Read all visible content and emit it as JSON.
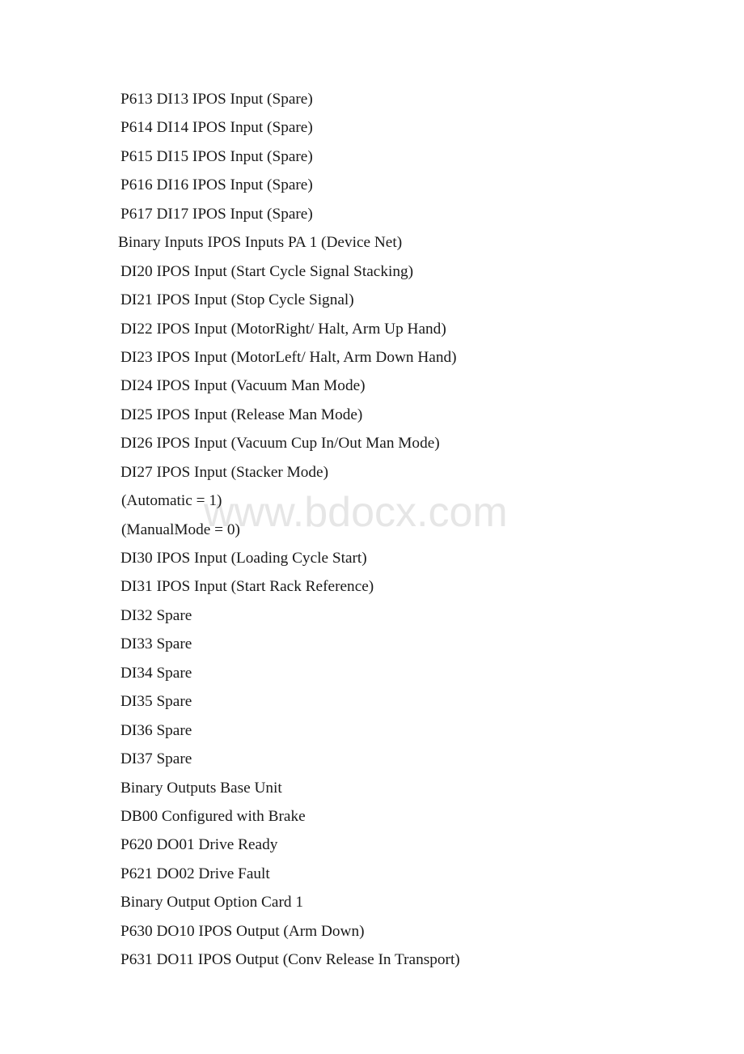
{
  "document": {
    "page_background": "#ffffff",
    "text_color": "#1a1a1a",
    "watermark": {
      "text": "www.bdocx.com",
      "color": "#e6e6e6"
    },
    "lines": [
      {
        "text": "P613 DI13 IPOS Input (Spare)",
        "indent": "normal"
      },
      {
        "text": "P614 DI14 IPOS Input (Spare)",
        "indent": "normal"
      },
      {
        "text": "P615 DI15 IPOS Input (Spare)",
        "indent": "normal"
      },
      {
        "text": "P616 DI16 IPOS Input (Spare)",
        "indent": "normal"
      },
      {
        "text": "P617 DI17 IPOS Input (Spare)",
        "indent": "normal"
      },
      {
        "text": "Binary Inputs IPOS Inputs PA 1 (Device Net)",
        "indent": "left"
      },
      {
        "text": "DI20 IPOS Input (Start Cycle Signal Stacking)",
        "indent": "normal"
      },
      {
        "text": "DI21 IPOS Input (Stop Cycle Signal)",
        "indent": "normal"
      },
      {
        "text": "DI22 IPOS Input (MotorRight/ Halt, Arm Up Hand)",
        "indent": "normal"
      },
      {
        "text": "DI23 IPOS Input (MotorLeft/ Halt, Arm Down Hand)",
        "indent": "normal"
      },
      {
        "text": "DI24 IPOS Input (Vacuum Man Mode)",
        "indent": "normal"
      },
      {
        "text": "DI25 IPOS Input (Release Man Mode)",
        "indent": "normal"
      },
      {
        "text": "DI26 IPOS Input (Vacuum Cup In/Out Man Mode)",
        "indent": "normal"
      },
      {
        "text": "DI27 IPOS Input (Stacker Mode)",
        "indent": "normal"
      },
      {
        "text": "(Automatic = 1)",
        "indent": "paren"
      },
      {
        "text": "(ManualMode = 0)",
        "indent": "paren"
      },
      {
        "text": "DI30 IPOS Input (Loading Cycle Start)",
        "indent": "normal"
      },
      {
        "text": "DI31 IPOS Input (Start Rack Reference)",
        "indent": "normal"
      },
      {
        "text": "DI32 Spare",
        "indent": "normal"
      },
      {
        "text": "DI33 Spare",
        "indent": "normal"
      },
      {
        "text": "DI34 Spare",
        "indent": "normal"
      },
      {
        "text": "DI35 Spare",
        "indent": "normal"
      },
      {
        "text": "DI36 Spare",
        "indent": "normal"
      },
      {
        "text": "DI37 Spare",
        "indent": "normal"
      },
      {
        "text": "Binary Outputs Base Unit",
        "indent": "normal"
      },
      {
        "text": "DB00 Configured with Brake",
        "indent": "normal"
      },
      {
        "text": "P620 DO01 Drive Ready",
        "indent": "normal"
      },
      {
        "text": "P621 DO02 Drive Fault",
        "indent": "normal"
      },
      {
        "text": "Binary Output Option Card 1",
        "indent": "normal"
      },
      {
        "text": "P630 DO10 IPOS Output (Arm Down)",
        "indent": "normal"
      },
      {
        "text": "P631 DO11 IPOS Output (Conv Release In Transport)",
        "indent": "normal"
      }
    ]
  }
}
